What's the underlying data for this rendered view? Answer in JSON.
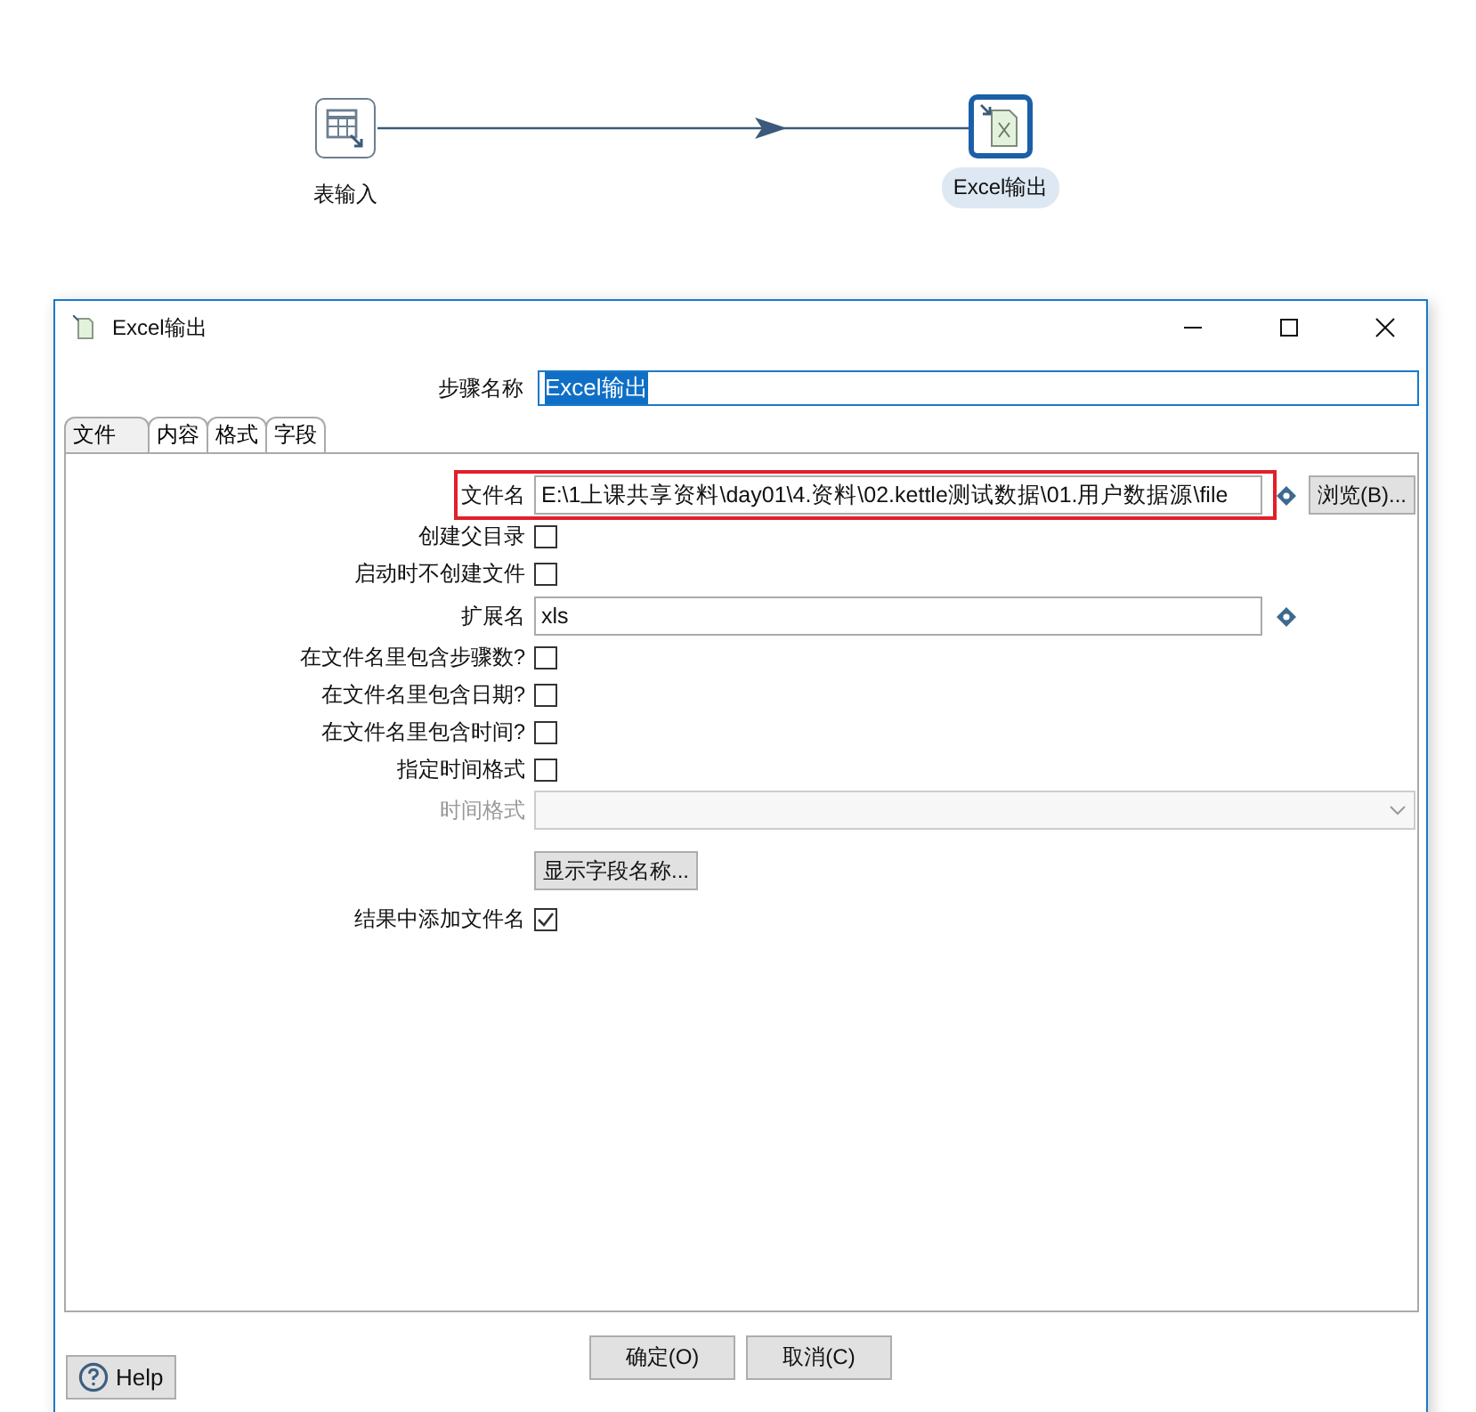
{
  "canvas": {
    "nodes": [
      {
        "label": "表输入",
        "kind": "table",
        "selected": false
      },
      {
        "label": "Excel输出",
        "kind": "excel",
        "selected": true
      }
    ]
  },
  "dialog": {
    "title": "Excel输出",
    "step_name_label": "步骤名称",
    "step_name_value": "Excel输出",
    "tabs": [
      {
        "label": "文件",
        "selected": true
      },
      {
        "label": "内容",
        "selected": false
      },
      {
        "label": "格式",
        "selected": false
      },
      {
        "label": "字段",
        "selected": false
      }
    ],
    "rows": [
      {
        "kind": "text",
        "label": "文件名",
        "value": "E:\\1上课共享资料\\day01\\4.资料\\02.kettle测试数据\\01.用户数据源\\file",
        "highlighted": true,
        "button": "浏览(B)..."
      },
      {
        "kind": "checkbox",
        "label": "创建父目录",
        "checked": false
      },
      {
        "kind": "checkbox",
        "label": "启动时不创建文件",
        "checked": false
      },
      {
        "kind": "text",
        "label": "扩展名",
        "value": "xls",
        "highlighted": false
      },
      {
        "kind": "checkbox",
        "label": "在文件名里包含步骤数?",
        "checked": false
      },
      {
        "kind": "checkbox",
        "label": "在文件名里包含日期?",
        "checked": false
      },
      {
        "kind": "checkbox",
        "label": "在文件名里包含时间?",
        "checked": false
      },
      {
        "kind": "checkbox",
        "label": "指定时间格式",
        "checked": false
      },
      {
        "kind": "select",
        "label": "时间格式",
        "disabled": true
      },
      {
        "kind": "button",
        "label": "显示字段名称..."
      },
      {
        "kind": "checkbox",
        "label": "结果中添加文件名",
        "checked": true
      }
    ],
    "ok_button": "确定(O)",
    "cancel_button": "取消(C)",
    "help_button": "Help"
  }
}
